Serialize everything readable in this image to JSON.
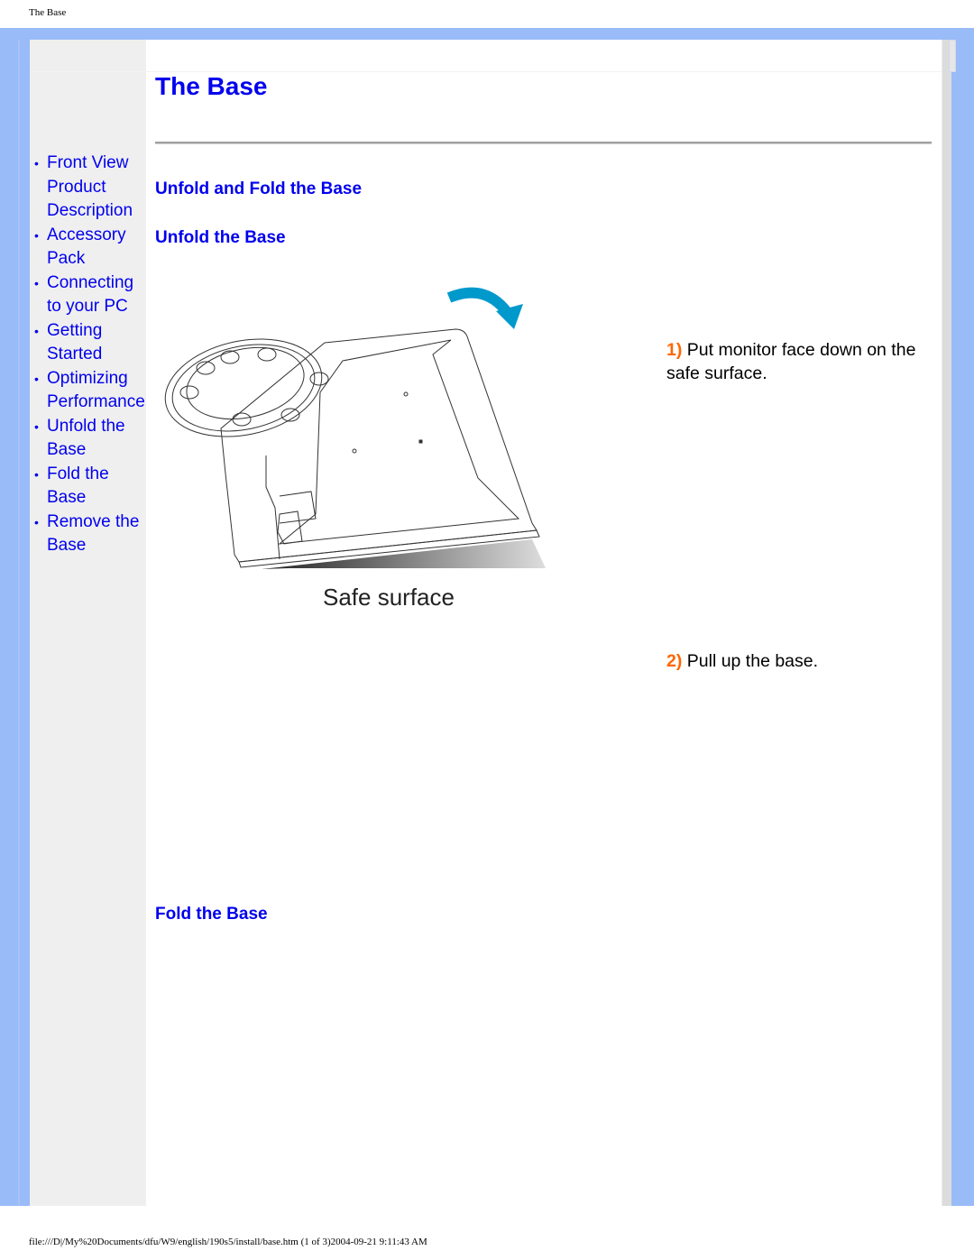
{
  "page_header": "The Base",
  "title": "The Base",
  "sidebar": {
    "items": [
      {
        "label": "Front View Product Description"
      },
      {
        "label": "Accessory Pack"
      },
      {
        "label": "Connecting to your PC"
      },
      {
        "label": "Getting Started"
      },
      {
        "label": "Optimizing Performance"
      },
      {
        "label": "Unfold the Base"
      },
      {
        "label": "Fold the Base"
      },
      {
        "label": "Remove the Base"
      }
    ],
    "bullet": "•"
  },
  "sections": {
    "main_heading": "Unfold and Fold the Base",
    "unfold_heading": "Unfold the Base",
    "fold_heading": "Fold the Base"
  },
  "steps": [
    {
      "number": "1)",
      "text": "Put monitor face down on the safe surface."
    },
    {
      "number": "2)",
      "text": "Pull up the base."
    }
  ],
  "illustration": {
    "caption": "Safe surface",
    "arrow_color": "#0099cc"
  },
  "colors": {
    "link": "#0000ee",
    "step_number": "#ff6600",
    "frame": "#99bbf7",
    "sidebar_bg": "#efefef"
  },
  "footer": "file:///D|/My%20Documents/dfu/W9/english/190s5/install/base.htm (1 of 3)2004-09-21 9:11:43 AM"
}
